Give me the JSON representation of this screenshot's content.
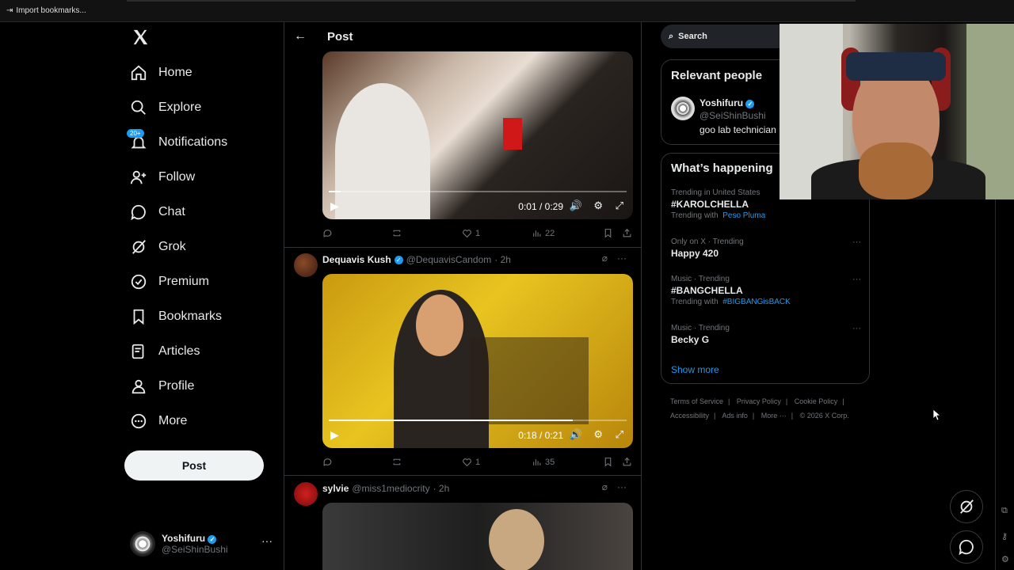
{
  "browser": {
    "import_bookmarks": "Import bookmarks..."
  },
  "nav": {
    "items": [
      {
        "label": "Home",
        "icon": "home-icon"
      },
      {
        "label": "Explore",
        "icon": "search-icon"
      },
      {
        "label": "Notifications",
        "icon": "bell-icon",
        "badge": "20+"
      },
      {
        "label": "Follow",
        "icon": "follow-icon"
      },
      {
        "label": "Chat",
        "icon": "chat-icon"
      },
      {
        "label": "Grok",
        "icon": "grok-icon"
      },
      {
        "label": "Premium",
        "icon": "premium-icon"
      },
      {
        "label": "Bookmarks",
        "icon": "bookmark-icon"
      },
      {
        "label": "Articles",
        "icon": "articles-icon"
      },
      {
        "label": "Profile",
        "icon": "profile-icon"
      },
      {
        "label": "More",
        "icon": "more-icon"
      }
    ],
    "post_button": "Post",
    "account": {
      "name": "Yoshifuru",
      "handle": "@SeiShinBushi",
      "more": "···"
    }
  },
  "main": {
    "title": "Post",
    "tweets": [
      {
        "video": {
          "time": "0:01 / 0:29",
          "progress": 0.04
        },
        "stats": {
          "replies": "",
          "retweets": "",
          "likes": "1",
          "views": "22"
        }
      },
      {
        "author": {
          "name": "Dequavis Kush",
          "handle": "@DequavisCandom",
          "time": "· 2h"
        },
        "video": {
          "time": "0:18 / 0:21",
          "progress": 0.82
        },
        "stats": {
          "replies": "",
          "retweets": "",
          "likes": "1",
          "views": "35"
        }
      },
      {
        "author": {
          "name": "sylvie",
          "handle": "@miss1mediocrity",
          "time": "· 2h"
        }
      }
    ]
  },
  "sidebar": {
    "search_placeholder": "Search",
    "relevant": {
      "title": "Relevant people",
      "name": "Yoshifuru",
      "handle": "@SeiShinBushi",
      "bio": "goo lab technician"
    },
    "happening": {
      "title": "What’s happening",
      "trends": [
        {
          "context": "Trending in United States",
          "name": "#KAROLCHELLA",
          "with_label": "Trending with",
          "with": "Peso Pluma"
        },
        {
          "context": "Only on X · Trending",
          "name": "Happy 420"
        },
        {
          "context": "Music · Trending",
          "name": "#BANGCHELLA",
          "with_label": "Trending with",
          "with": "#BIGBANGisBACK"
        },
        {
          "context": "Music · Trending",
          "name": "Becky G"
        }
      ],
      "show_more": "Show more"
    },
    "footer": {
      "links": [
        "Terms of Service",
        "Privacy Policy",
        "Cookie Policy",
        "Accessibility",
        "Ads info",
        "More ···",
        "© 2026 X Corp."
      ],
      "separator": "|"
    }
  },
  "colors": {
    "accent": "#1d9bf0",
    "bg": "#000000",
    "text": "#e7e9ea",
    "muted": "#71767b"
  }
}
